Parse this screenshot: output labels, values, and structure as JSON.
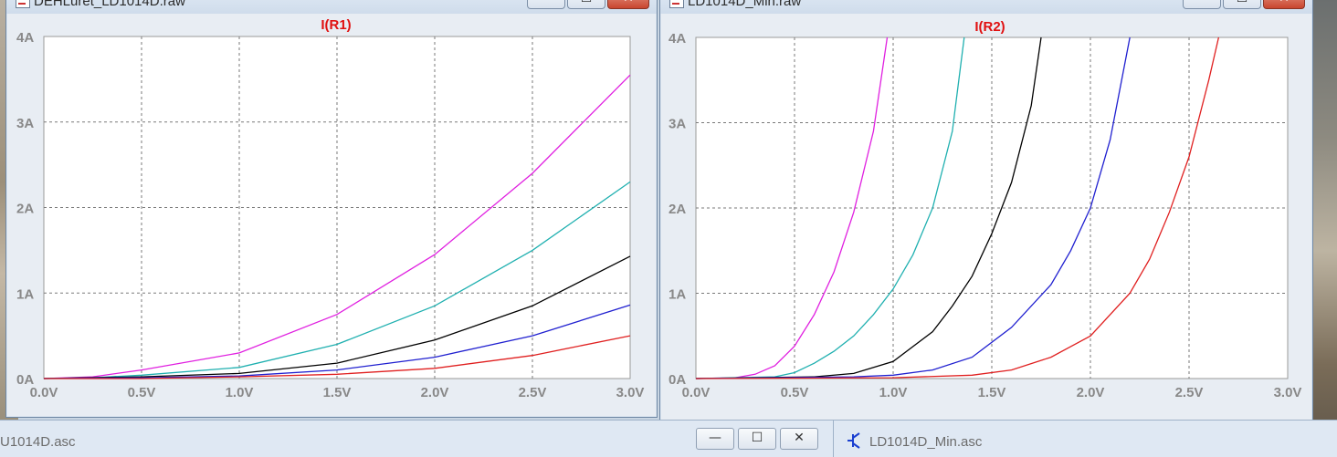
{
  "left_window": {
    "title": "DEHLuret_LD1014D.raw",
    "minimize_glyph": "—",
    "maximize_glyph": "☐",
    "close_glyph": "✕"
  },
  "right_window": {
    "title": "LD1014D_Min.raw",
    "minimize_glyph": "—",
    "maximize_glyph": "☐",
    "close_glyph": "✕"
  },
  "taskbar": {
    "left_label": "U1014D.asc",
    "right_label": "LD1014D_Min.asc",
    "minimize_glyph": "—",
    "maximize_glyph": "☐",
    "close_glyph": "✕"
  },
  "colors": {
    "trace_title": "#e01010",
    "grid": "#7a7a7a",
    "axis_text": "#888888",
    "magenta": "#e020e0",
    "cyan": "#20b0b0",
    "black": "#000000",
    "blue": "#2020d0",
    "red": "#e02020"
  },
  "chart_data": [
    {
      "type": "line",
      "title": "I(R1)",
      "x_ticks": [
        "0.0V",
        "0.5V",
        "1.0V",
        "1.5V",
        "2.0V",
        "2.5V",
        "3.0V"
      ],
      "y_ticks": [
        "0A",
        "1A",
        "2A",
        "3A",
        "4A"
      ],
      "xlim": [
        0,
        3
      ],
      "ylim": [
        0,
        4
      ],
      "grid": true,
      "series": [
        {
          "color": "magenta",
          "points": [
            [
              0,
              0
            ],
            [
              0.25,
              0.02
            ],
            [
              0.5,
              0.1
            ],
            [
              1.0,
              0.3
            ],
            [
              1.5,
              0.75
            ],
            [
              2.0,
              1.45
            ],
            [
              2.5,
              2.4
            ],
            [
              3.0,
              3.55
            ]
          ]
        },
        {
          "color": "cyan",
          "points": [
            [
              0,
              0
            ],
            [
              0.25,
              0.01
            ],
            [
              0.5,
              0.04
            ],
            [
              1.0,
              0.13
            ],
            [
              1.5,
              0.4
            ],
            [
              2.0,
              0.85
            ],
            [
              2.5,
              1.5
            ],
            [
              3.0,
              2.3
            ]
          ]
        },
        {
          "color": "black",
          "points": [
            [
              0,
              0
            ],
            [
              0.5,
              0.02
            ],
            [
              1.0,
              0.06
            ],
            [
              1.5,
              0.18
            ],
            [
              2.0,
              0.45
            ],
            [
              2.5,
              0.85
            ],
            [
              3.0,
              1.43
            ]
          ]
        },
        {
          "color": "blue",
          "points": [
            [
              0,
              0
            ],
            [
              0.5,
              0.01
            ],
            [
              1.0,
              0.03
            ],
            [
              1.5,
              0.1
            ],
            [
              2.0,
              0.25
            ],
            [
              2.5,
              0.5
            ],
            [
              3.0,
              0.86
            ]
          ]
        },
        {
          "color": "red",
          "points": [
            [
              0,
              0
            ],
            [
              0.5,
              0.0
            ],
            [
              1.0,
              0.02
            ],
            [
              1.5,
              0.05
            ],
            [
              2.0,
              0.12
            ],
            [
              2.5,
              0.27
            ],
            [
              3.0,
              0.5
            ]
          ]
        }
      ]
    },
    {
      "type": "line",
      "title": "I(R2)",
      "x_ticks": [
        "0.0V",
        "0.5V",
        "1.0V",
        "1.5V",
        "2.0V",
        "2.5V",
        "3.0V"
      ],
      "y_ticks": [
        "0A",
        "1A",
        "2A",
        "3A",
        "4A"
      ],
      "xlim": [
        0,
        3
      ],
      "ylim": [
        0,
        4
      ],
      "grid": true,
      "series": [
        {
          "color": "magenta",
          "points": [
            [
              0,
              0
            ],
            [
              0.2,
              0.01
            ],
            [
              0.3,
              0.05
            ],
            [
              0.4,
              0.15
            ],
            [
              0.5,
              0.38
            ],
            [
              0.6,
              0.75
            ],
            [
              0.7,
              1.25
            ],
            [
              0.8,
              1.95
            ],
            [
              0.9,
              2.9
            ],
            [
              0.97,
              4.0
            ]
          ]
        },
        {
          "color": "cyan",
          "points": [
            [
              0,
              0
            ],
            [
              0.4,
              0.02
            ],
            [
              0.5,
              0.07
            ],
            [
              0.6,
              0.18
            ],
            [
              0.7,
              0.32
            ],
            [
              0.8,
              0.5
            ],
            [
              0.9,
              0.75
            ],
            [
              1.0,
              1.05
            ],
            [
              1.1,
              1.45
            ],
            [
              1.2,
              2.0
            ],
            [
              1.3,
              2.9
            ],
            [
              1.36,
              4.0
            ]
          ]
        },
        {
          "color": "black",
          "points": [
            [
              0,
              0
            ],
            [
              0.6,
              0.02
            ],
            [
              0.8,
              0.06
            ],
            [
              1.0,
              0.2
            ],
            [
              1.2,
              0.55
            ],
            [
              1.3,
              0.85
            ],
            [
              1.4,
              1.2
            ],
            [
              1.5,
              1.7
            ],
            [
              1.6,
              2.3
            ],
            [
              1.7,
              3.2
            ],
            [
              1.75,
              4.0
            ]
          ]
        },
        {
          "color": "blue",
          "points": [
            [
              0,
              0
            ],
            [
              0.8,
              0.02
            ],
            [
              1.0,
              0.04
            ],
            [
              1.2,
              0.1
            ],
            [
              1.4,
              0.25
            ],
            [
              1.6,
              0.6
            ],
            [
              1.8,
              1.1
            ],
            [
              1.9,
              1.5
            ],
            [
              2.0,
              2.0
            ],
            [
              2.1,
              2.8
            ],
            [
              2.2,
              4.0
            ]
          ]
        },
        {
          "color": "red",
          "points": [
            [
              0,
              0
            ],
            [
              1.0,
              0.01
            ],
            [
              1.4,
              0.04
            ],
            [
              1.6,
              0.1
            ],
            [
              1.8,
              0.25
            ],
            [
              2.0,
              0.5
            ],
            [
              2.2,
              1.0
            ],
            [
              2.3,
              1.4
            ],
            [
              2.4,
              1.95
            ],
            [
              2.5,
              2.6
            ],
            [
              2.6,
              3.5
            ],
            [
              2.65,
              4.0
            ]
          ]
        }
      ]
    }
  ]
}
